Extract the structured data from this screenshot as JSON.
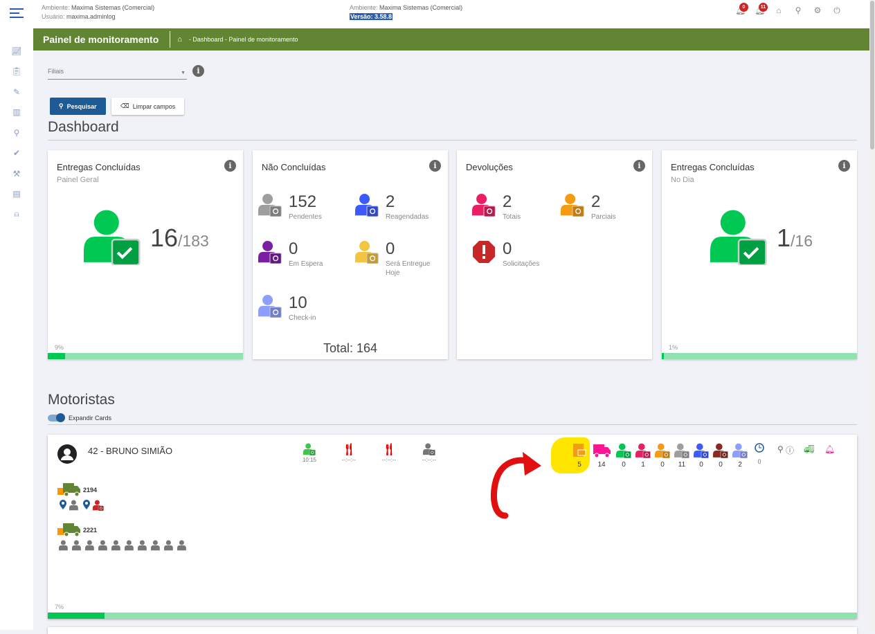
{
  "header": {
    "env_label": "Ambiente:",
    "env_value": "Maxima Sistemas (Comercial)",
    "user_label": "Usuário:",
    "user_value": "maxima.adminlog",
    "env2_label": "Ambiente:",
    "env2_value": "Maxima Sistemas (Comercial)",
    "version": "Versão: 3.58.8",
    "badge1": "0",
    "badge2": "11"
  },
  "sidebar": {
    "items": [
      "chart-line-icon",
      "clipboard-icon",
      "pencil-icon",
      "bar-chart-icon",
      "search-icon",
      "double-check-icon",
      "wrench-icon",
      "document-icon",
      "antenna-icon"
    ]
  },
  "titlebar": {
    "title": "Painel de monitoramento",
    "breadcrumb": "- Dashboard - Painel de monitoramento"
  },
  "filters": {
    "filiais_placeholder": "Filiais",
    "search_label": "Pesquisar",
    "clear_label": "Limpar campos"
  },
  "dashboard": {
    "title": "Dashboard",
    "cards": [
      {
        "title": "Entregas Concluídas",
        "subtitle": "Painel Geral",
        "value": "16",
        "total": "/183",
        "percent_label": "9%",
        "percent": 9
      },
      {
        "title": "Não Concluídas",
        "stats": [
          {
            "value": "152",
            "label": "Pendentes",
            "color": "#9e9e9e"
          },
          {
            "value": "2",
            "label": "Reagendadas",
            "color": "#3d5afe"
          },
          {
            "value": "0",
            "label": "Em Espera",
            "color": "#7b1fa2"
          },
          {
            "value": "0",
            "label": "Será Entregue Hoje",
            "color": "#f4c542"
          },
          {
            "value": "10",
            "label": "Check-in",
            "color": "#8c9eff"
          }
        ],
        "total": "Total: 164"
      },
      {
        "title": "Devoluções",
        "stats": [
          {
            "value": "2",
            "label": "Totais",
            "color": "#e91e63"
          },
          {
            "value": "2",
            "label": "Parciais",
            "color": "#f39c12"
          },
          {
            "value": "0",
            "label": "Solicitações",
            "color": "#c62828"
          }
        ]
      },
      {
        "title": "Entregas Concluídas",
        "subtitle": "No Dia",
        "value": "1",
        "total": "/16",
        "percent_label": "1%",
        "percent": 1
      }
    ]
  },
  "motoristas": {
    "title": "Motoristas",
    "expand_label": "Expandir Cards",
    "driver": {
      "name": "42 - BRUNO SIMIÃO",
      "events": [
        {
          "icon": "person-clock-icon",
          "value": "10:15",
          "color": "#3cc74a"
        },
        {
          "icon": "fork-knife-icon",
          "value": "--:--:--",
          "color": "#e00000"
        },
        {
          "icon": "fork-knife-icon",
          "value": "--:--:--",
          "color": "#e00000"
        },
        {
          "icon": "person-clock-icon",
          "value": "--:--:--",
          "color": "#777777"
        }
      ],
      "kpis": [
        {
          "icon": "invoice-icon",
          "value": "5",
          "color": "#f39c12"
        },
        {
          "icon": "truck-icon",
          "value": "14",
          "color": "#ff1493"
        },
        {
          "icon": "person-check-icon",
          "value": "0",
          "color": "#00c853"
        },
        {
          "icon": "person-cancel-icon",
          "value": "1",
          "color": "#e91e63"
        },
        {
          "icon": "person-clock-icon",
          "value": "0",
          "color": "#f39c12"
        },
        {
          "icon": "person-pending-icon",
          "value": "11",
          "color": "#9e9e9e"
        },
        {
          "icon": "person-reschedule-icon",
          "value": "0",
          "color": "#3d5afe"
        },
        {
          "icon": "person-dollar-icon",
          "value": "0",
          "color": "#8b2a1e"
        },
        {
          "icon": "person-pin-icon",
          "value": "2",
          "color": "#8c9eff"
        },
        {
          "icon": "clock-icon",
          "value": "0",
          "color": "#1e5a96"
        }
      ],
      "vehicles": [
        {
          "id": "2194"
        },
        {
          "id": "2221"
        }
      ],
      "percent_label": "7%",
      "percent": 7
    }
  },
  "colors": {
    "brand_green": "#628534",
    "success": "#00c853",
    "primary": "#1e5a96"
  }
}
